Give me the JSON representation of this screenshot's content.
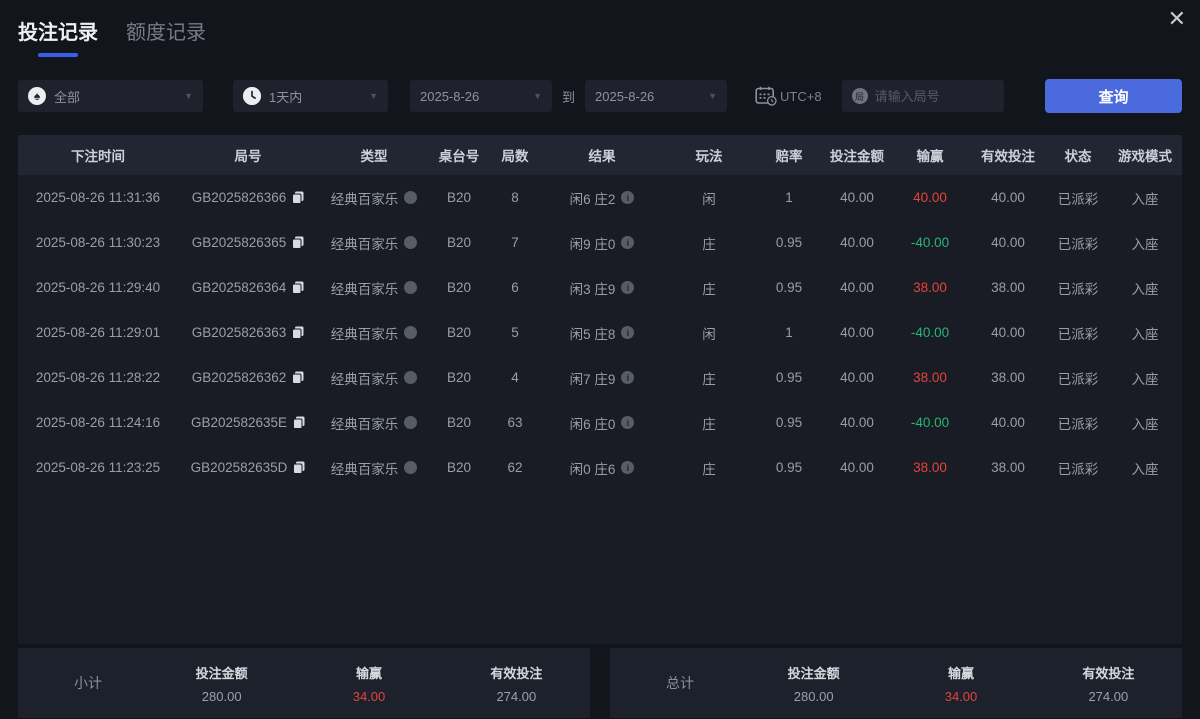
{
  "colors": {
    "accent_blue": "#4b6ade",
    "win_red": "#e2453c",
    "loss_green": "#27b673",
    "tab_underline": "#3a5de8"
  },
  "tabs": {
    "bet_records": "投注记录",
    "quota_records": "额度记录"
  },
  "icons": {
    "close": "✕",
    "caret": "▼",
    "spade": "♠",
    "round_badge": "局",
    "info_glyph": "i"
  },
  "filters": {
    "game_filter": {
      "value": "全部"
    },
    "time_filter": {
      "value": "1天内"
    },
    "date_from": {
      "value": "2025-8-26"
    },
    "to_label": "到",
    "date_to": {
      "value": "2025-8-26"
    },
    "timezone": "UTC+8",
    "round_search": {
      "placeholder": "请输入局号"
    },
    "query_button": "查询"
  },
  "table": {
    "columns": [
      "下注时间",
      "局号",
      "类型",
      "桌台号",
      "局数",
      "结果",
      "玩法",
      "赔率",
      "投注金额",
      "输赢",
      "有效投注",
      "状态",
      "游戏模式"
    ],
    "rows": [
      {
        "time": "2025-08-26 11:31:36",
        "round_id": "GB2025826366",
        "game_type": "经典百家乐",
        "table_no": "B20",
        "round_count": "8",
        "result": "闲6 庄2",
        "play": "闲",
        "odds": "1",
        "bet_amount": "40.00",
        "win_loss": "40.00",
        "valid_bet": "40.00",
        "status": "已派彩",
        "mode": "入座"
      },
      {
        "time": "2025-08-26 11:30:23",
        "round_id": "GB2025826365",
        "game_type": "经典百家乐",
        "table_no": "B20",
        "round_count": "7",
        "result": "闲9 庄0",
        "play": "庄",
        "odds": "0.95",
        "bet_amount": "40.00",
        "win_loss": "-40.00",
        "valid_bet": "40.00",
        "status": "已派彩",
        "mode": "入座"
      },
      {
        "time": "2025-08-26 11:29:40",
        "round_id": "GB2025826364",
        "game_type": "经典百家乐",
        "table_no": "B20",
        "round_count": "6",
        "result": "闲3 庄9",
        "play": "庄",
        "odds": "0.95",
        "bet_amount": "40.00",
        "win_loss": "38.00",
        "valid_bet": "38.00",
        "status": "已派彩",
        "mode": "入座"
      },
      {
        "time": "2025-08-26 11:29:01",
        "round_id": "GB2025826363",
        "game_type": "经典百家乐",
        "table_no": "B20",
        "round_count": "5",
        "result": "闲5 庄8",
        "play": "闲",
        "odds": "1",
        "bet_amount": "40.00",
        "win_loss": "-40.00",
        "valid_bet": "40.00",
        "status": "已派彩",
        "mode": "入座"
      },
      {
        "time": "2025-08-26 11:28:22",
        "round_id": "GB2025826362",
        "game_type": "经典百家乐",
        "table_no": "B20",
        "round_count": "4",
        "result": "闲7 庄9",
        "play": "庄",
        "odds": "0.95",
        "bet_amount": "40.00",
        "win_loss": "38.00",
        "valid_bet": "38.00",
        "status": "已派彩",
        "mode": "入座"
      },
      {
        "time": "2025-08-26 11:24:16",
        "round_id": "GB202582635E",
        "game_type": "经典百家乐",
        "table_no": "B20",
        "round_count": "63",
        "result": "闲6 庄0",
        "play": "庄",
        "odds": "0.95",
        "bet_amount": "40.00",
        "win_loss": "-40.00",
        "valid_bet": "40.00",
        "status": "已派彩",
        "mode": "入座"
      },
      {
        "time": "2025-08-26 11:23:25",
        "round_id": "GB202582635D",
        "game_type": "经典百家乐",
        "table_no": "B20",
        "round_count": "62",
        "result": "闲0 庄6",
        "play": "庄",
        "odds": "0.95",
        "bet_amount": "40.00",
        "win_loss": "38.00",
        "valid_bet": "38.00",
        "status": "已派彩",
        "mode": "入座"
      }
    ]
  },
  "summary": {
    "subtotal": {
      "label": "小计",
      "bet_amount_label": "投注金额",
      "bet_amount": "280.00",
      "winloss_label": "输赢",
      "winloss": "34.00",
      "valid_label": "有效投注",
      "valid": "274.00"
    },
    "total": {
      "label": "总计",
      "bet_amount_label": "投注金额",
      "bet_amount": "280.00",
      "winloss_label": "输赢",
      "winloss": "34.00",
      "valid_label": "有效投注",
      "valid": "274.00"
    }
  }
}
